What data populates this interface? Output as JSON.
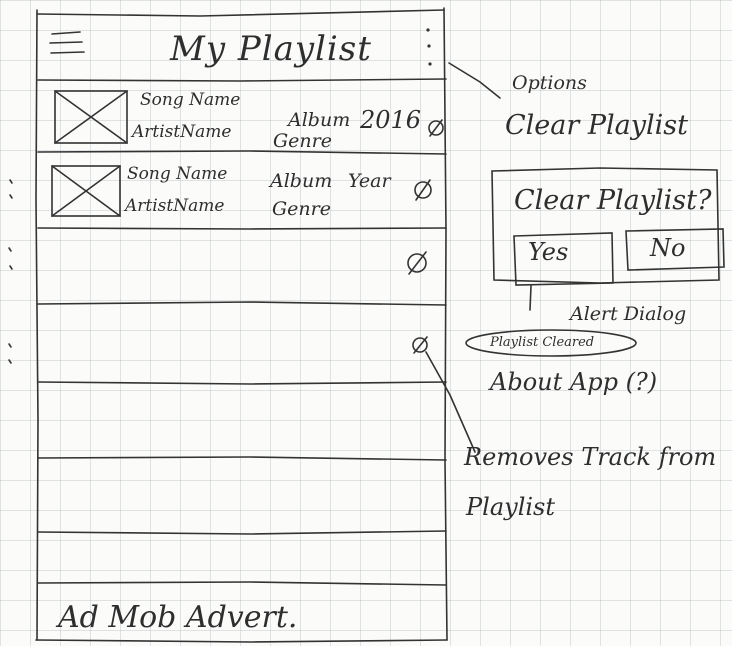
{
  "phone": {
    "title": "My Playlist",
    "tracks": [
      {
        "song": "Song Name",
        "artist": "ArtistName",
        "album": "Album",
        "genre": "Genre",
        "year": "2016"
      },
      {
        "song": "Song Name",
        "artist": "ArtistName",
        "album": "Album",
        "genre": "Genre",
        "year": "Year"
      }
    ],
    "ad_banner": "Ad Mob Advert."
  },
  "annotations": {
    "options": "Options",
    "clear_playlist": "Clear Playlist",
    "alert_dialog": "Alert Dialog",
    "toast": "Playlist Cleared",
    "about_app": "About App (?)",
    "removes_track": "Removes Track from",
    "removes_track_2": "Playlist"
  },
  "dialog": {
    "question": "Clear Playlist?",
    "yes": "Yes",
    "no": "No"
  }
}
